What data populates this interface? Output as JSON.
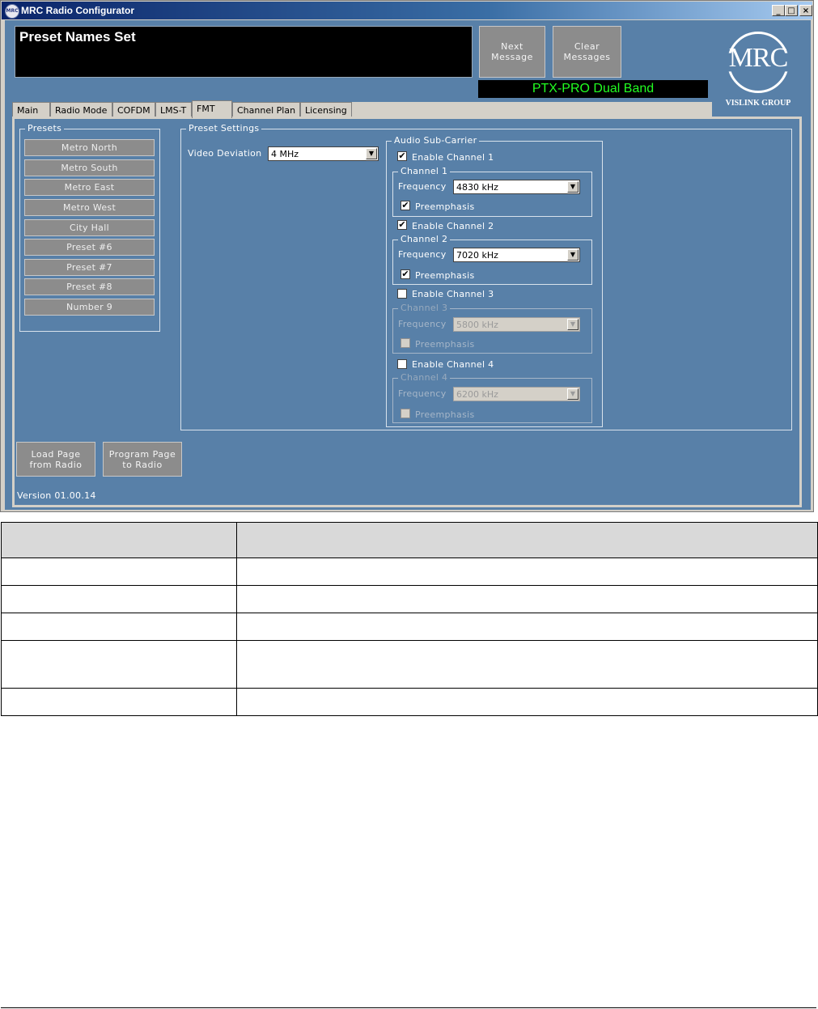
{
  "window": {
    "title": "MRC Radio Configurator",
    "app_icon_text": "MRC",
    "controls": {
      "minimize": "_",
      "maximize": "□",
      "close": "×"
    }
  },
  "message": {
    "text": "Preset Names Set"
  },
  "buttons": {
    "next_message": [
      "Next",
      "Message"
    ],
    "clear_messages": [
      "Clear",
      "Messages"
    ],
    "load_page": [
      "Load Page",
      "from Radio"
    ],
    "program_page": [
      "Program Page",
      "to Radio"
    ]
  },
  "device_label": "PTX-PRO Dual Band",
  "logo": {
    "brand": "MRC",
    "group": "VISLINK GROUP"
  },
  "tabs": [
    {
      "label": "Main"
    },
    {
      "label": "Radio Mode"
    },
    {
      "label": "COFDM"
    },
    {
      "label": "LMS-T"
    },
    {
      "label": "FMT",
      "active": true
    },
    {
      "label": "Channel Plan"
    },
    {
      "label": "Licensing"
    }
  ],
  "presets": {
    "title": "Presets",
    "items": [
      "Metro North",
      "Metro South",
      "Metro East",
      "Metro West",
      "City Hall",
      "Preset #6",
      "Preset #7",
      "Preset #8",
      "Number 9"
    ]
  },
  "preset_settings": {
    "title": "Preset Settings",
    "video_deviation_label": "Video Deviation",
    "video_deviation_value": "4 MHz"
  },
  "audio": {
    "title": "Audio Sub-Carrier",
    "frequency_label": "Frequency",
    "preemphasis_label": "Preemphasis",
    "check_mark": "✔",
    "combo_arrow": "▼",
    "channels": [
      {
        "enable_label": "Enable Channel 1",
        "group_title": "Channel 1",
        "enabled": true,
        "frequency": "4830 kHz",
        "preemphasis": true
      },
      {
        "enable_label": "Enable Channel 2",
        "group_title": "Channel 2",
        "enabled": true,
        "frequency": "7020 kHz",
        "preemphasis": true
      },
      {
        "enable_label": "Enable Channel 3",
        "group_title": "Channel 3",
        "enabled": false,
        "frequency": "5800 kHz",
        "preemphasis": false
      },
      {
        "enable_label": "Enable Channel 4",
        "group_title": "Channel 4",
        "enabled": false,
        "frequency": "6200 kHz",
        "preemphasis": false
      }
    ]
  },
  "version": "Version 01.00.14"
}
